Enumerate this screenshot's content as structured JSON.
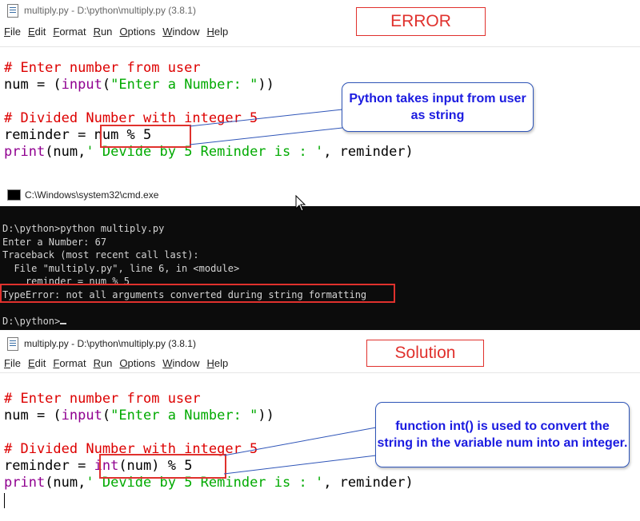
{
  "top_window": {
    "title": "multiply.py - D:\\python\\multiply.py (3.8.1)",
    "menu": [
      "File",
      "Edit",
      "Format",
      "Run",
      "Options",
      "Window",
      "Help"
    ],
    "label": "ERROR",
    "code": {
      "comment1": "# Enter number from user",
      "num_var": "num = (",
      "input_kw": "input",
      "input_open": "(",
      "input_str": "\"Enter a Number: \"",
      "input_close": "))",
      "comment2": "# Divided Number with integer 5",
      "rem_var": "reminder = ",
      "rem_expr": "num % 5",
      "print_kw": "print",
      "print_args1": "(num,",
      "print_str": "' Devide by 5 Reminder is : '",
      "print_args2": ", reminder)"
    },
    "callout": "Python takes input from user as string"
  },
  "cmd_window": {
    "title": "C:\\Windows\\system32\\cmd.exe",
    "lines": [
      "D:\\python>python multiply.py",
      "Enter a Number: 67",
      "Traceback (most recent call last):",
      "  File \"multiply.py\", line 6, in <module>",
      "    reminder = num % 5"
    ],
    "error_line": "TypeError: not all arguments converted during string formatting",
    "prompt": "D:\\python>"
  },
  "bottom_window": {
    "title": "multiply.py - D:\\python\\multiply.py (3.8.1)",
    "menu": [
      "File",
      "Edit",
      "Format",
      "Run",
      "Options",
      "Window",
      "Help"
    ],
    "label": "Solution",
    "code": {
      "comment1": "# Enter number from user",
      "num_var": "num = (",
      "input_kw": "input",
      "input_open": "(",
      "input_str": "\"Enter a Number: \"",
      "input_close": "))",
      "comment2": "# Divided Number with integer 5",
      "rem_var": "reminder = ",
      "int_kw": "int",
      "int_rest": "(num) % 5",
      "print_kw": "print",
      "print_args1": "(num,",
      "print_str": "' Devide by 5 Reminder is : '",
      "print_args2": ", reminder)"
    },
    "callout": "function int() is used to convert the string in the variable num into an integer."
  },
  "colors": {
    "comment": "#dd0000",
    "builtin": "#900090",
    "string": "#00aa00",
    "highlight_box": "#e0312d",
    "callout_text": "#1b1be0"
  }
}
